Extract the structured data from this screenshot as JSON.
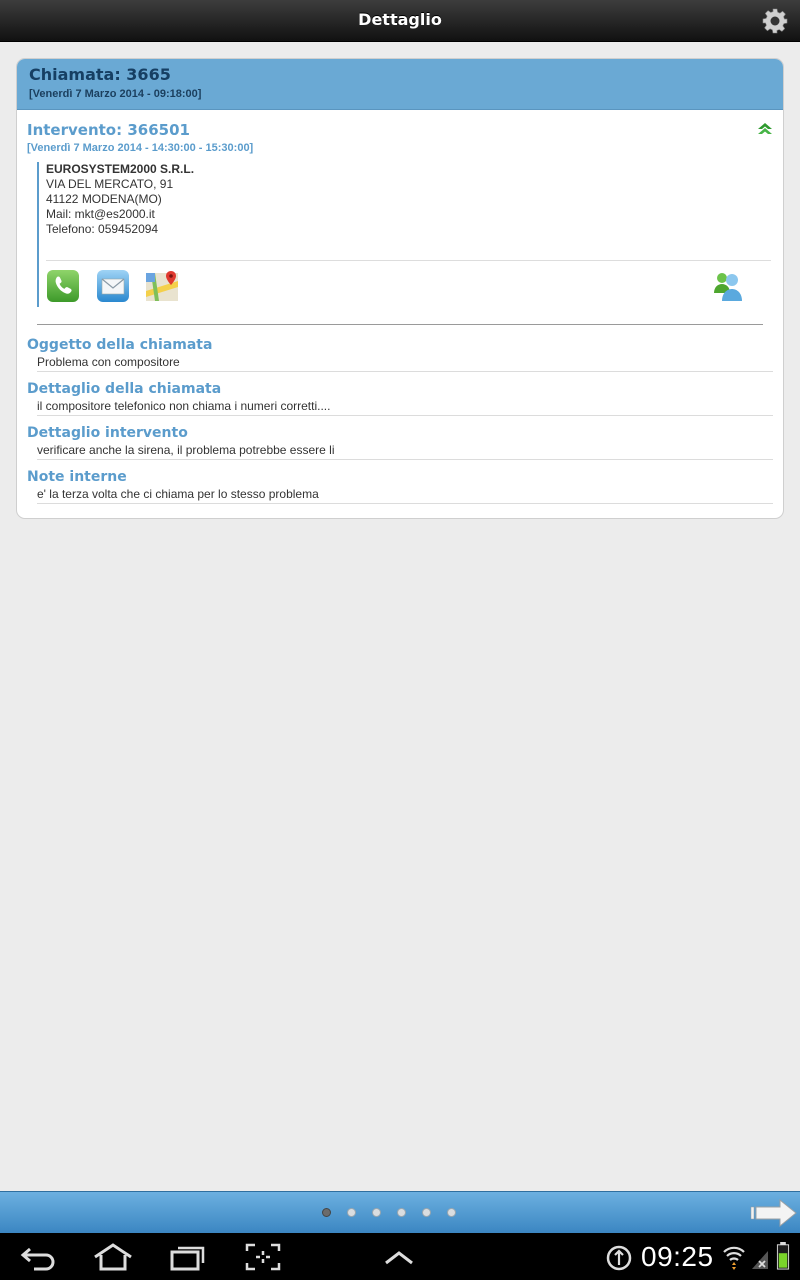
{
  "header": {
    "title": "Dettaglio",
    "settings_icon": "gear-icon"
  },
  "call": {
    "title": "Chiamata: 3665",
    "date": "[Venerdì 7 Marzo 2014 - 09:18:00]"
  },
  "intervention": {
    "title": "Intervento: 366501",
    "date": "[Venerdì 7 Marzo 2014 - 14:30:00 - 15:30:00]",
    "collapse_icon": "chevron-up-double-icon"
  },
  "contact": {
    "company": "EUROSYSTEM2000 S.R.L.",
    "address": "VIA DEL MERCATO, 91",
    "city": "41122 MODENA(MO)",
    "mail": "Mail: mkt@es2000.it",
    "phone": "Telefono: 059452094",
    "actions": [
      "phone-icon",
      "mail-icon",
      "maps-icon",
      "contacts-icon"
    ]
  },
  "sections": [
    {
      "label": "Oggetto della chiamata",
      "value": "Problema con compositore"
    },
    {
      "label": "Dettaglio della chiamata",
      "value": "il compositore telefonico non chiama i numeri corretti...."
    },
    {
      "label": "Dettaglio intervento",
      "value": "verificare anche la sirena, il problema potrebbe essere li"
    },
    {
      "label": "Note interne",
      "value": "e' la terza volta che ci chiama per lo stesso problema"
    }
  ],
  "pager": {
    "page_count": 6,
    "active_page": 1
  },
  "system_bar": {
    "clock": "09:25"
  },
  "colors": {
    "header_dark": "#111111",
    "card_header": "#6aa9d4",
    "accent_text": "#5b9ccc",
    "pager_bar": "#3b86c2"
  }
}
